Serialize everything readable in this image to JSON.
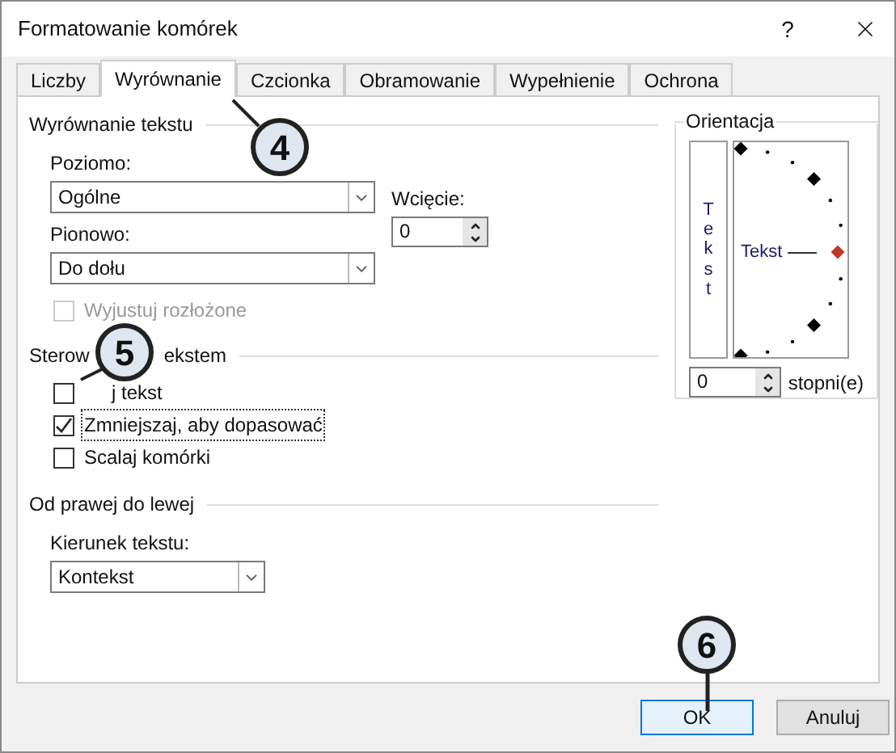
{
  "window": {
    "title": "Formatowanie komórek",
    "help": "?"
  },
  "tabs": [
    {
      "label": "Liczby",
      "selected": false
    },
    {
      "label": "Wyrównanie",
      "selected": true
    },
    {
      "label": "Czcionka",
      "selected": false
    },
    {
      "label": "Obramowanie",
      "selected": false
    },
    {
      "label": "Wypełnienie",
      "selected": false
    },
    {
      "label": "Ochrona",
      "selected": false
    }
  ],
  "text_alignment": {
    "title": "Wyrównanie tekstu",
    "horizontal": {
      "label": "Poziomo:",
      "value": "Ogólne"
    },
    "indent": {
      "label": "Wcięcie:",
      "value": "0"
    },
    "vertical": {
      "label": "Pionowo:",
      "value": "Do dołu"
    },
    "justify": {
      "label": "Wyjustuj rozłożone",
      "checked": false,
      "disabled": true
    }
  },
  "text_control": {
    "title_parts": [
      "Sterow",
      "ekstem"
    ],
    "options": [
      {
        "label": "j tekst",
        "checked": false,
        "focused": false
      },
      {
        "label": "Zmniejszaj, aby dopasować",
        "checked": true,
        "focused": true
      },
      {
        "label": "Scalaj komórki",
        "checked": false,
        "focused": false
      }
    ]
  },
  "right_to_left": {
    "title": "Od prawej do lewej",
    "direction": {
      "label": "Kierunek tekstu:",
      "value": "Kontekst"
    }
  },
  "orientation": {
    "title": "Orientacja",
    "vertical_text": "Tekst",
    "dial_text": "Tekst",
    "degrees": "0",
    "unit": "stopni(e)"
  },
  "buttons": [
    {
      "label": "OK",
      "default": true
    },
    {
      "label": "Anuluj",
      "default": false
    }
  ],
  "callouts": [
    "4",
    "5",
    "6"
  ]
}
